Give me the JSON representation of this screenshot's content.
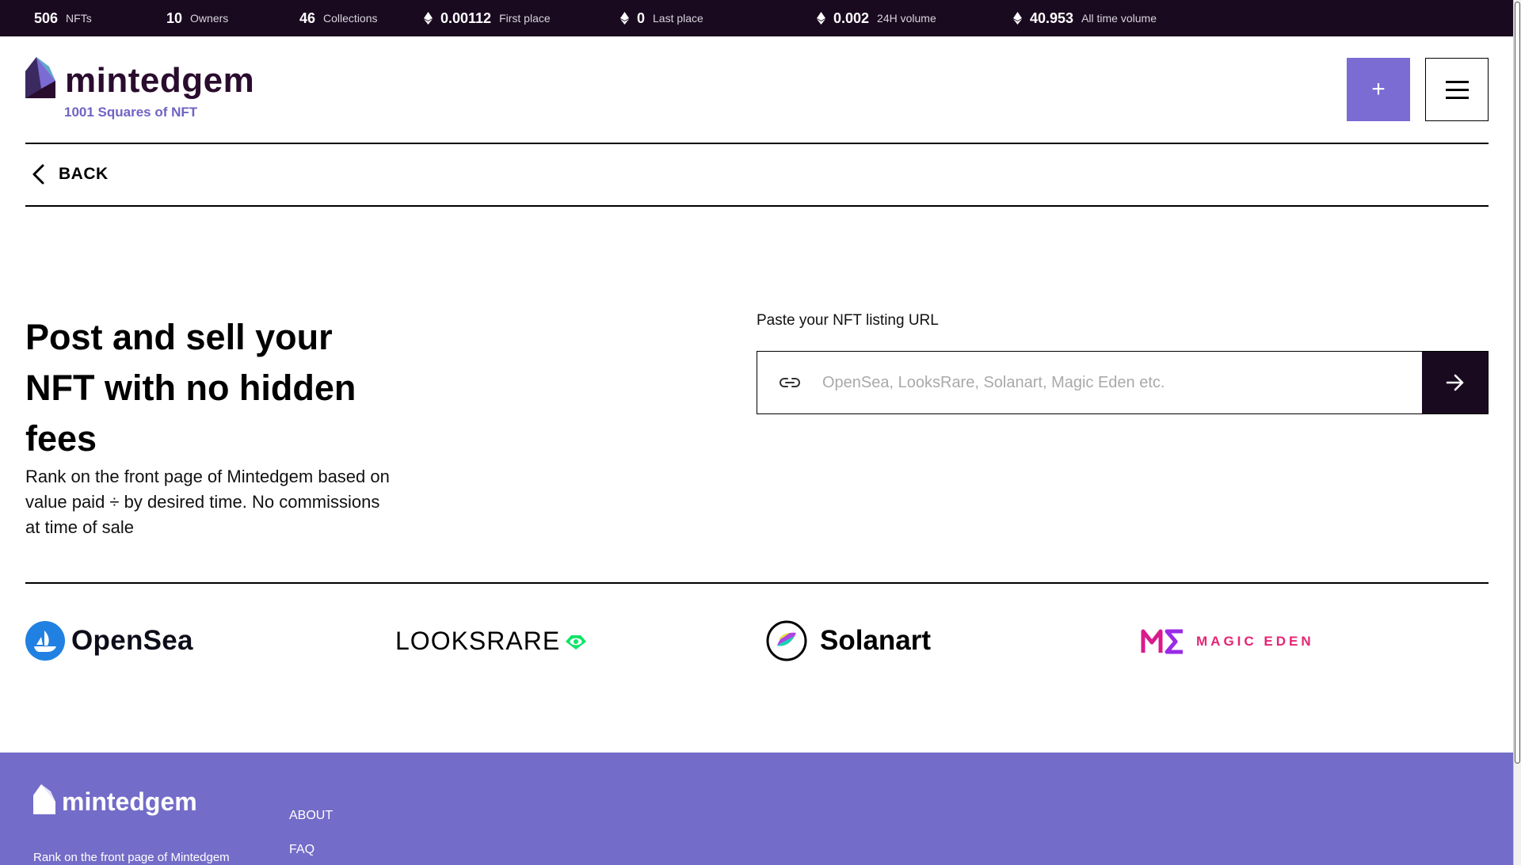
{
  "stats": [
    {
      "value": "506",
      "label": "NFTs",
      "eth": false
    },
    {
      "value": "10",
      "label": "Owners",
      "eth": false
    },
    {
      "value": "46",
      "label": "Collections",
      "eth": false
    },
    {
      "value": "0.00112",
      "label": "First place",
      "eth": true
    },
    {
      "value": "0",
      "label": "Last place",
      "eth": true
    },
    {
      "value": "0.002",
      "label": "24H volume",
      "eth": true
    },
    {
      "value": "40.953",
      "label": "All time volume",
      "eth": true
    }
  ],
  "header": {
    "brand": "mintedgem",
    "tagline": "1001 Squares of NFT",
    "add_label": "+"
  },
  "nav": {
    "back_label": "BACK"
  },
  "hero": {
    "title": "Post and sell your NFT with no hidden fees",
    "description": "Rank on the front page of Mintedgem based on value paid ÷ by desired time. No commissions at time of sale"
  },
  "form": {
    "label": "Paste your NFT listing URL",
    "placeholder": "OpenSea, LooksRare, Solanart, Magic Eden etc.",
    "value": ""
  },
  "marketplaces": {
    "opensea": "OpenSea",
    "looksrare": "LOOKSRARE",
    "solanart": "Solanart",
    "magiceden": "MAGIC EDEN"
  },
  "footer": {
    "brand": "mintedgem",
    "tagline": "Rank on the front page of Mintedgem",
    "links": [
      "ABOUT",
      "FAQ"
    ]
  },
  "colors": {
    "topbar": "#1a0a20",
    "accent": "#7a6cd3",
    "footer": "#736cc8",
    "brand_text": "#2a0c2e"
  }
}
